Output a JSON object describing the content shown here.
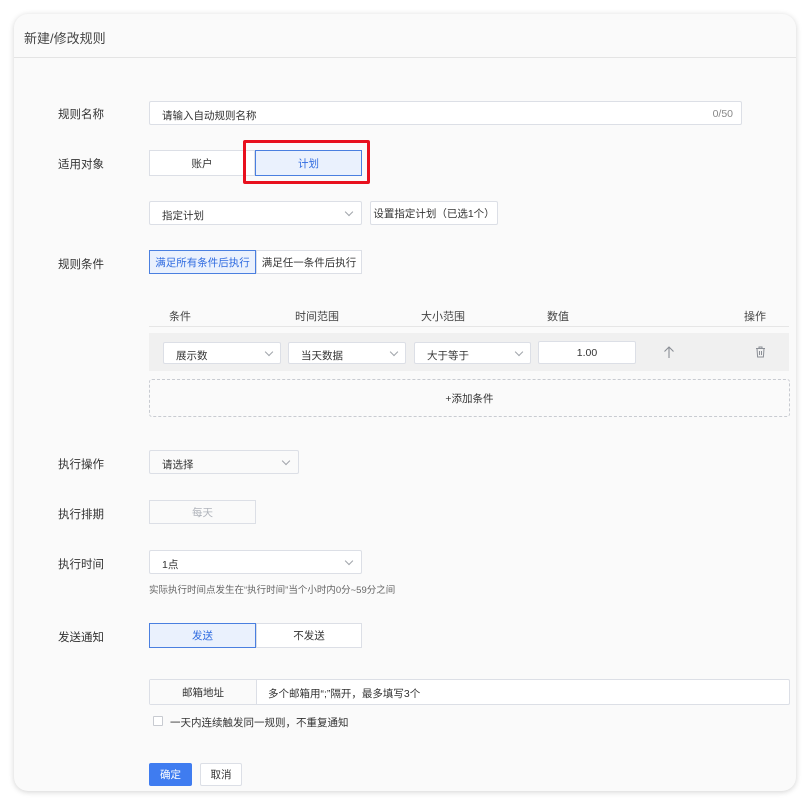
{
  "dialog": {
    "title": "新建/修改规则"
  },
  "labels": {
    "rule_name": "规则名称",
    "target": "适用对象",
    "conditions": "规则条件",
    "action": "执行操作",
    "schedule": "执行排期",
    "time": "执行时间",
    "notify": "发送通知"
  },
  "rule_name": {
    "placeholder": "请输入自动规则名称",
    "counter": "0/50"
  },
  "target": {
    "options": [
      "账户",
      "计划"
    ],
    "selected": "计划",
    "plan_select": "指定计划",
    "set_plan_button": "设置指定计划（已选1个）"
  },
  "condition_mode": {
    "options": [
      "满足所有条件后执行",
      "满足任一条件后执行"
    ],
    "selected": "满足所有条件后执行"
  },
  "table": {
    "headers": [
      "条件",
      "时间范围",
      "大小范围",
      "数值",
      "操作"
    ],
    "row": {
      "condition": "展示数",
      "time_range": "当天数据",
      "comparison": "大于等于",
      "value": "1.00"
    },
    "add_label": "+添加条件"
  },
  "action": {
    "placeholder": "请选择"
  },
  "schedule": {
    "value": "每天"
  },
  "time": {
    "value": "1点",
    "hint": "实际执行时间点发生在“执行时间”当个小时内0分~59分之间"
  },
  "notify": {
    "options": [
      "发送",
      "不发送"
    ],
    "selected": "发送",
    "email_label": "邮箱地址",
    "email_placeholder": "多个邮箱用“;”隔开，最多填写3个",
    "checkbox_label": "一天内连续触发同一规则，不重复通知"
  },
  "footer": {
    "confirm": "确定",
    "cancel": "取消"
  }
}
